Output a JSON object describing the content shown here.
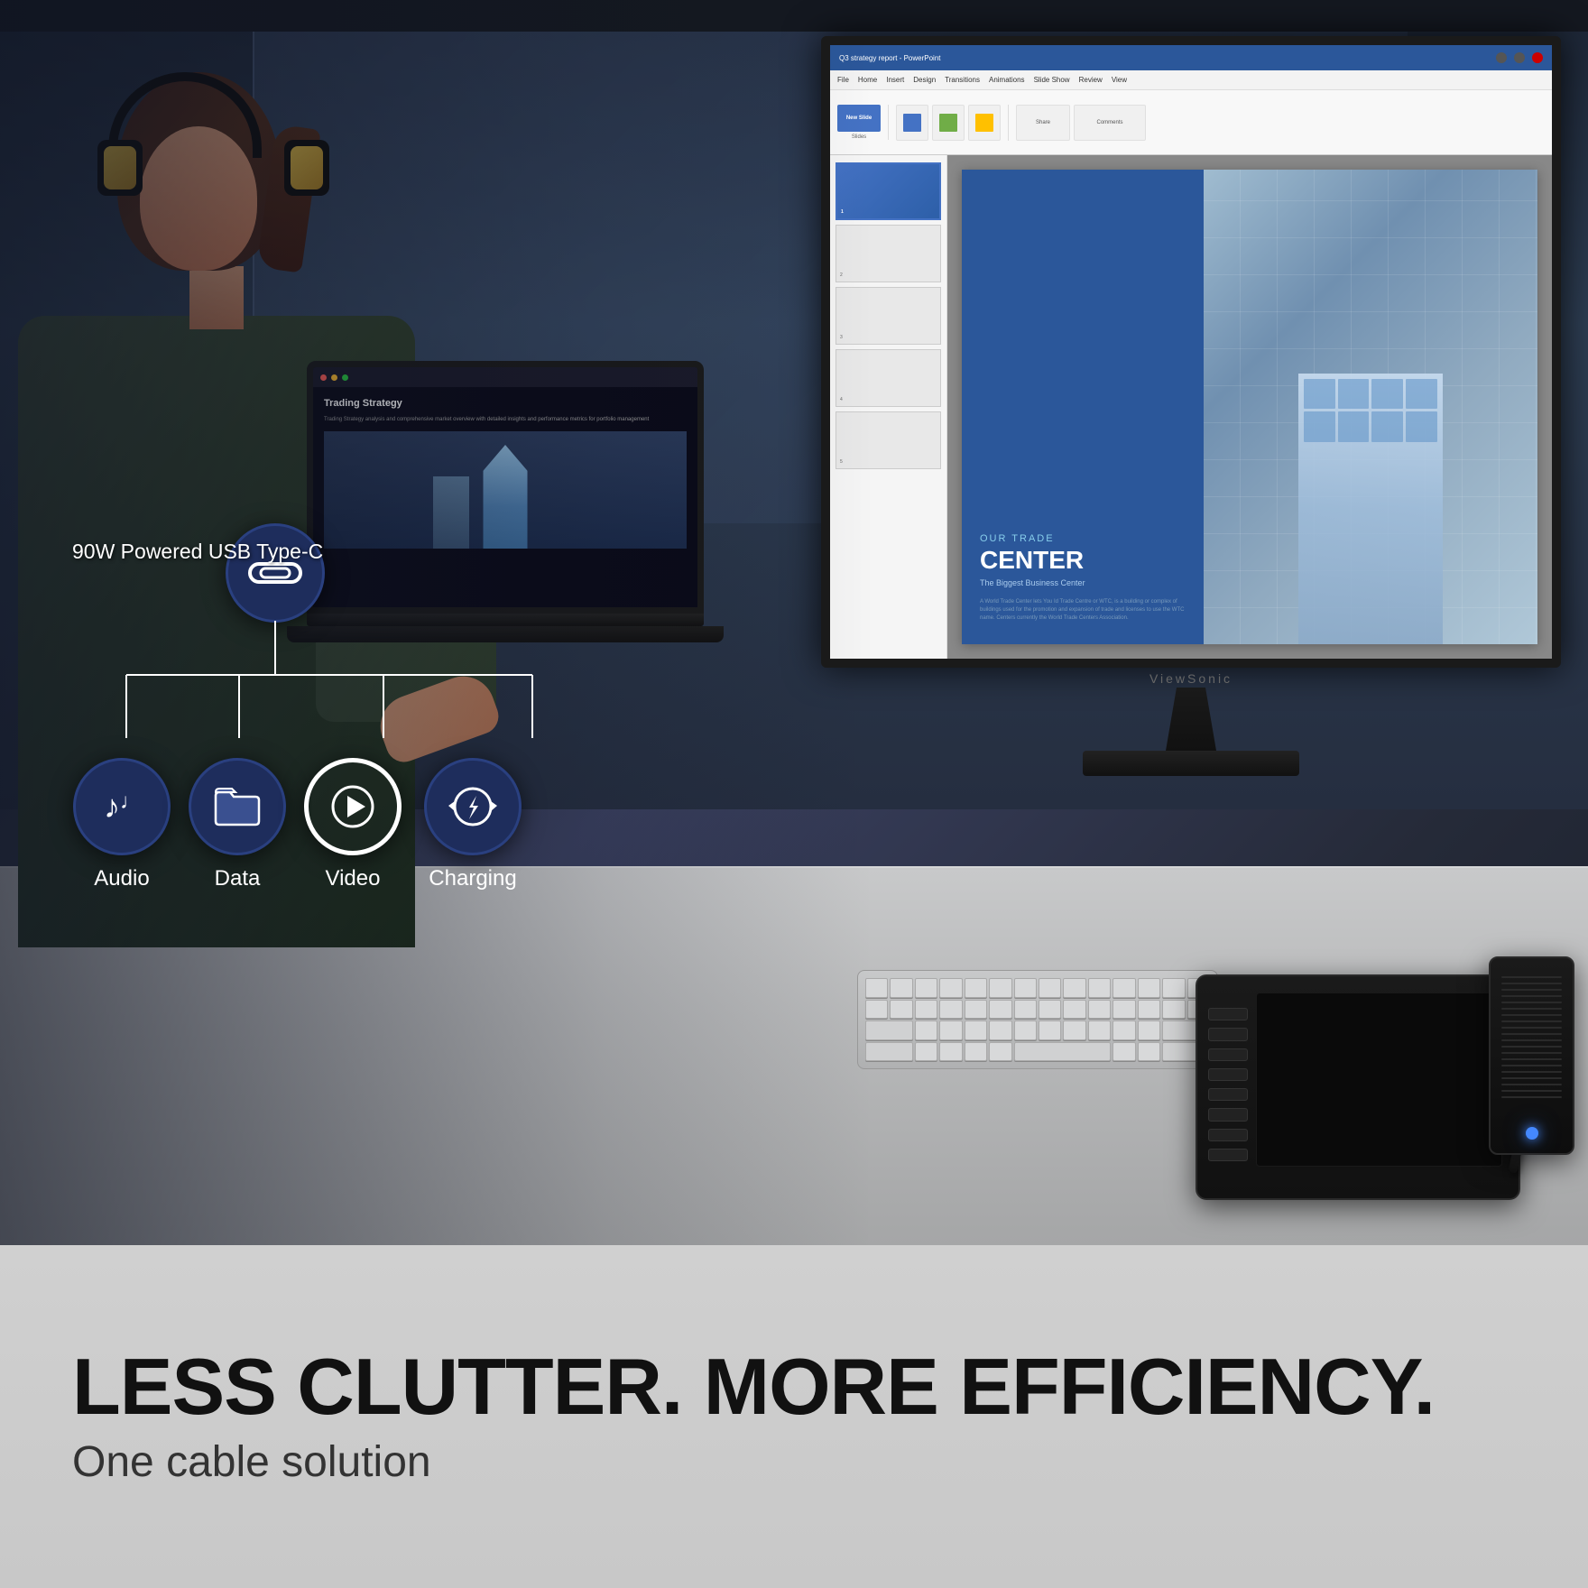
{
  "scene": {
    "bg_color": "#1a1f2c",
    "desk_color": "#c8c9ca"
  },
  "usb_feature": {
    "main_icon_label": "USB-C",
    "main_label": "90W Powered USB Type-C",
    "features": [
      {
        "id": "audio",
        "label": "Audio",
        "icon": "music-note"
      },
      {
        "id": "data",
        "label": "Data",
        "icon": "folder"
      },
      {
        "id": "video",
        "label": "Video",
        "icon": "play-circle",
        "style": "outline"
      },
      {
        "id": "charging",
        "label": "Charging",
        "icon": "lightning-circle"
      }
    ]
  },
  "slide_content": {
    "tag": "OUR TRADE",
    "title": "CENTER",
    "subtitle": "The Biggest Business Center",
    "body": "A World Trade Center lets You Id Trade Centre or WTC, is a building or complex of buildings used for the promotion and expansion of trade and licenses to use the WTC name. Centers currently the World Trade Centers Association."
  },
  "laptop_content": {
    "title": "Trading Strategy",
    "body_text": "Trading Strategy analysis and comprehensive market overview with detailed insights and performance metrics for portfolio management"
  },
  "monitor": {
    "brand": "ViewSonic"
  },
  "banner": {
    "headline": "LESS CLUTTER. MORE EFFICIENCY.",
    "subheadline": "One cable solution"
  }
}
